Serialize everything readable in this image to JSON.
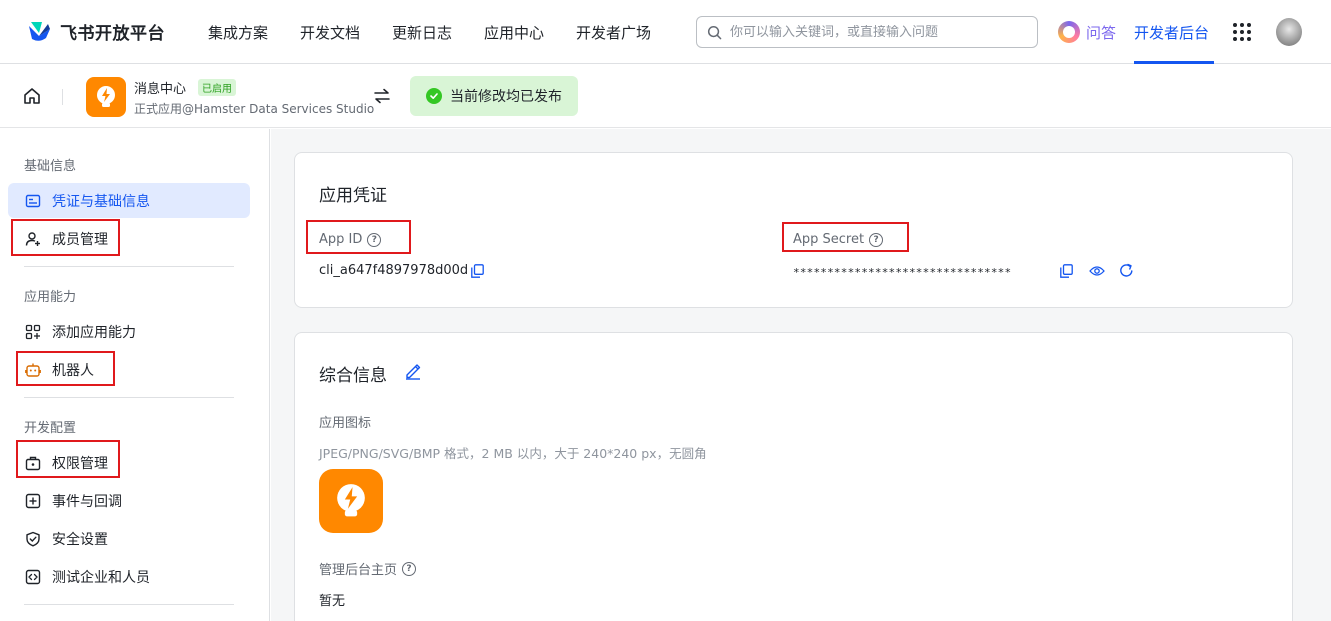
{
  "brand": {
    "name": "飞书开放平台"
  },
  "nav": {
    "items": [
      "集成方案",
      "开发文档",
      "更新日志",
      "应用中心",
      "开发者广场"
    ],
    "search_placeholder": "你可以输入关键词，或直接输入问题",
    "ask_label": "问答",
    "dev_console_label": "开发者后台"
  },
  "app": {
    "name": "消息中心",
    "status_badge": "已启用",
    "subtitle": "正式应用@Hamster Data Services Studio",
    "publish_status": "当前修改均已发布"
  },
  "sidebar": {
    "groups": [
      {
        "title": "基础信息",
        "items": [
          "凭证与基础信息",
          "成员管理"
        ]
      },
      {
        "title": "应用能力",
        "items": [
          "添加应用能力",
          "机器人"
        ]
      },
      {
        "title": "开发配置",
        "items": [
          "权限管理",
          "事件与回调",
          "安全设置",
          "测试企业和人员"
        ]
      }
    ]
  },
  "credentials": {
    "title": "应用凭证",
    "app_id_label": "App ID",
    "app_id_value": "cli_a647f4897978d00d",
    "app_secret_label": "App Secret",
    "app_secret_value": "********************************"
  },
  "general": {
    "title": "综合信息",
    "icon_label": "应用图标",
    "icon_hint": "JPEG/PNG/SVG/BMP 格式，2 MB 以内，大于 240*240 px，无圆角",
    "admin_home_label": "管理后台主页",
    "admin_home_value": "暂无"
  },
  "colors": {
    "accent": "#1456f0",
    "app_icon": "#ff8800",
    "highlight_box": "#e0191c",
    "success": "#34c724"
  }
}
